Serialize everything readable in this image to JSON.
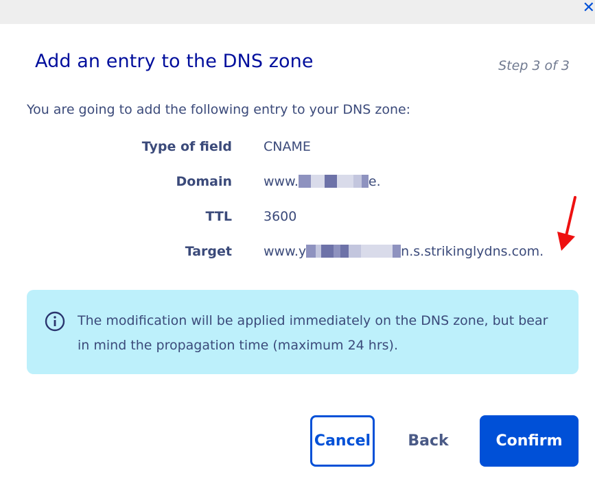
{
  "dialog": {
    "title": "Add an entry to the DNS zone",
    "step": "Step 3 of 3",
    "intro": "You are going to add the following entry to your DNS zone:",
    "fields": [
      {
        "label": "Type of field",
        "value": "CNAME"
      },
      {
        "label": "Domain",
        "value_prefix": "www.",
        "value_suffix": "e."
      },
      {
        "label": "TTL",
        "value": "3600"
      },
      {
        "label": "Target",
        "value_prefix": "www.y",
        "value_suffix": "n.s.strikinglydns.com."
      }
    ],
    "info_message": "The modification will be applied immediately on the DNS zone, but bear in mind the propagation time (maximum 24 hrs).",
    "buttons": {
      "cancel": "Cancel",
      "back": "Back",
      "confirm": "Confirm"
    },
    "close_symbol": "✕"
  },
  "icons": {
    "close": "close-icon",
    "info": "info-icon",
    "annotation": "red-arrow-icon"
  },
  "colors": {
    "primary": "#0050d7",
    "title": "#000e9c",
    "text": "#3b4a7a",
    "info_background": "#bdf0fb",
    "annotation": "#ee1111"
  }
}
